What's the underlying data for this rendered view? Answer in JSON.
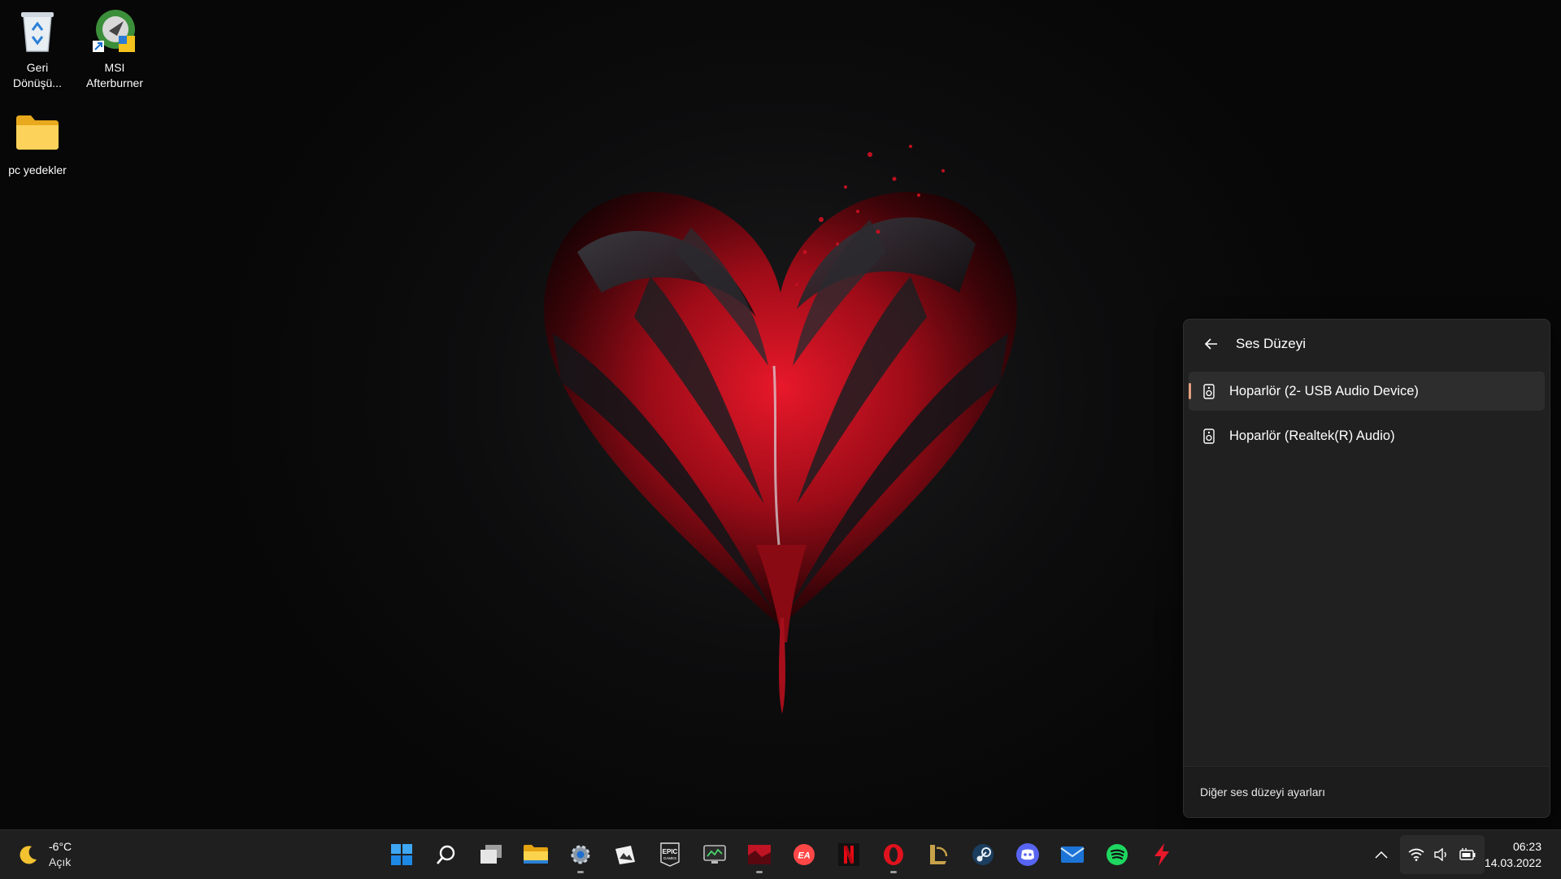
{
  "desktop": {
    "icons": [
      {
        "label": "Geri\nDönüşü...",
        "icon": "recycle-bin-icon"
      },
      {
        "label": "MSI\nAfterburner",
        "icon": "msi-afterburner-icon"
      },
      {
        "label": "pc yedekler",
        "icon": "folder-icon"
      }
    ]
  },
  "volume_flyout": {
    "title": "Ses Düzeyi",
    "devices": [
      {
        "label": "Hoparlör (2- USB Audio Device)",
        "selected": true
      },
      {
        "label": "Hoparlör (Realtek(R) Audio)",
        "selected": false
      }
    ],
    "footer_link": "Diğer ses düzeyi ayarları",
    "accent_color": "#e3a07f"
  },
  "taskbar": {
    "weather": {
      "temp": "-6°C",
      "condition": "Açık",
      "icon": "moon-icon"
    },
    "apps": [
      {
        "name": "start-button",
        "icon": "windows-logo-icon",
        "running": false
      },
      {
        "name": "search-button",
        "icon": "search-icon",
        "running": false
      },
      {
        "name": "task-view-button",
        "icon": "task-view-icon",
        "running": false
      },
      {
        "name": "file-explorer-app",
        "icon": "folder-icon",
        "running": false
      },
      {
        "name": "settings-app",
        "icon": "gear-icon",
        "running": true
      },
      {
        "name": "photo-app",
        "icon": "photo-icon",
        "running": false
      },
      {
        "name": "epic-games-app",
        "icon": "epic-games-icon",
        "running": false
      },
      {
        "name": "gpu-monitor-app",
        "icon": "monitor-icon",
        "running": false
      },
      {
        "name": "wallpaper-app",
        "icon": "wallpaper-icon",
        "running": true
      },
      {
        "name": "ea-app",
        "icon": "ea-icon",
        "running": false
      },
      {
        "name": "netflix-app",
        "icon": "netflix-icon",
        "running": false
      },
      {
        "name": "opera-app",
        "icon": "opera-icon",
        "running": true
      },
      {
        "name": "league-of-legends-app",
        "icon": "league-icon",
        "running": false
      },
      {
        "name": "steam-app",
        "icon": "steam-icon",
        "running": false
      },
      {
        "name": "discord-app",
        "icon": "discord-icon",
        "running": false
      },
      {
        "name": "mail-app",
        "icon": "mail-icon",
        "running": false
      },
      {
        "name": "spotify-app",
        "icon": "spotify-icon",
        "running": false
      },
      {
        "name": "bolt-app",
        "icon": "lightning-icon",
        "running": false
      }
    ],
    "tray": {
      "icons": [
        "chevron-up-icon",
        "wifi-icon",
        "speaker-icon",
        "battery-icon"
      ]
    },
    "clock": {
      "time": "06:23",
      "date": "14.03.2022"
    }
  }
}
